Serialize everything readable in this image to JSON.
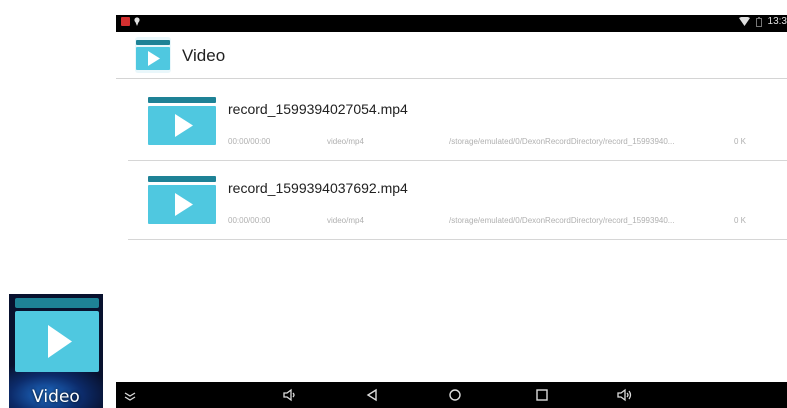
{
  "status_bar": {
    "time": "13:3",
    "icons": [
      "notification-icon",
      "location-pin-icon",
      "wifi-icon",
      "battery-icon"
    ]
  },
  "app_bar": {
    "title": "Video",
    "icon": "video-app-icon"
  },
  "videos": [
    {
      "name": "record_1599394027054.mp4",
      "duration": "00:00/00:00",
      "type": "video/mp4",
      "path": "/storage/emulated/0/DexonRecordDirectory/record_15993940...",
      "size": "0 K"
    },
    {
      "name": "record_1599394037692.mp4",
      "duration": "00:00/00:00",
      "type": "video/mp4",
      "path": "/storage/emulated/0/DexonRecordDirectory/record_15993940...",
      "size": "0 K"
    }
  ],
  "desktop_shortcut": {
    "label": "Video"
  },
  "nav_bar": {
    "buttons": [
      "collapse-icon",
      "volume-down-icon",
      "back-icon",
      "home-icon",
      "recents-icon",
      "volume-up-icon"
    ]
  },
  "colors": {
    "accent": "#4fc8e0",
    "accent_dark": "#1e8296",
    "bar": "#000000"
  }
}
